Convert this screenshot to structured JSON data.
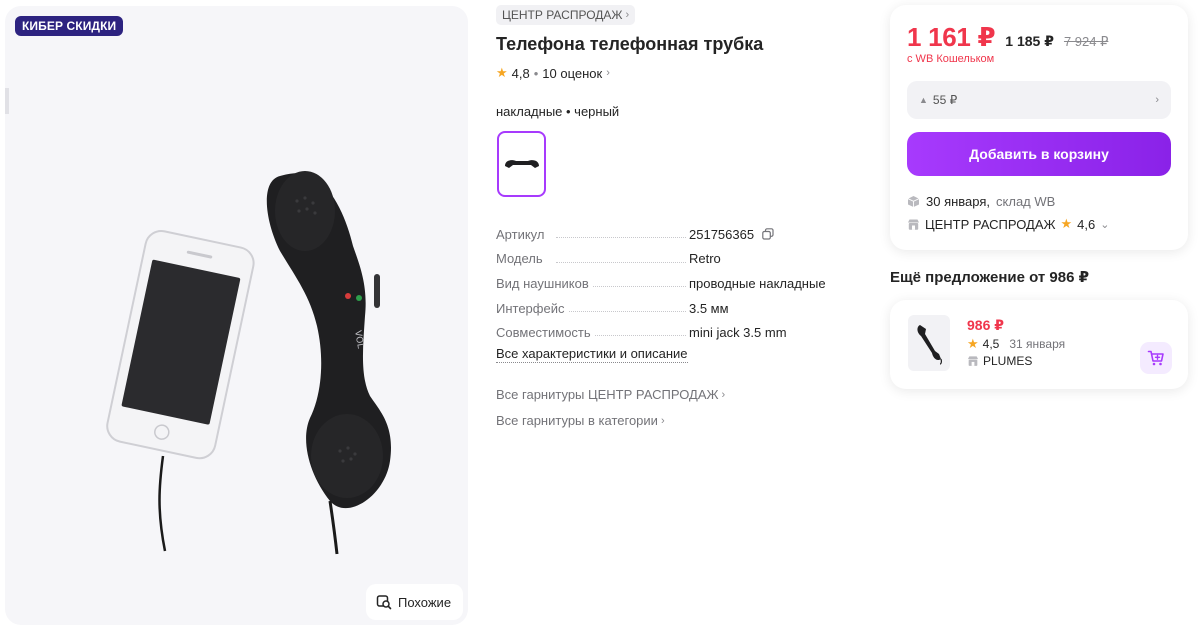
{
  "gallery": {
    "badge": "КИБЕР СКИДКИ",
    "similar_button": "Похожие"
  },
  "product": {
    "brand": "ЦЕНТР РАСПРОДАЖ",
    "title": "Телефона телефонная трубка",
    "rating": "4,8",
    "reviews": "10 оценок",
    "variant_label": "накладные • черный",
    "specs": [
      {
        "key": "Артикул",
        "value": "251756365"
      },
      {
        "key": "Модель",
        "value": "Retro"
      },
      {
        "key": "Вид наушников",
        "value": "проводные накладные"
      },
      {
        "key": "Интерфейс",
        "value": "3.5 мм"
      },
      {
        "key": "Совместимость",
        "value": "mini jack 3.5 mm"
      }
    ],
    "all_specs_link": "Все характеристики и описание",
    "links": [
      "Все гарнитуры ЦЕНТР РАСПРОДАЖ",
      "Все гарнитуры в категории"
    ]
  },
  "buy": {
    "price": "1 161 ₽",
    "price_mid": "1 185 ₽",
    "price_old": "7 924 ₽",
    "wallet_note": "с WB Кошельком",
    "cashback": "55 ₽",
    "cart_button": "Добавить в корзину",
    "delivery_date": "30 января,",
    "delivery_place": "склад WB",
    "seller": "ЦЕНТР РАСПРОДАЖ",
    "seller_rating": "4,6"
  },
  "other_offer": {
    "heading": "Ещё предложение от 986 ₽",
    "price": "986 ₽",
    "rating": "4,5",
    "date": "31 января",
    "seller": "PLUMES"
  },
  "colors": {
    "accent": "#a73afd",
    "price_red": "#f0364c",
    "badge_bg": "#2d2380",
    "star": "#f6a623"
  }
}
